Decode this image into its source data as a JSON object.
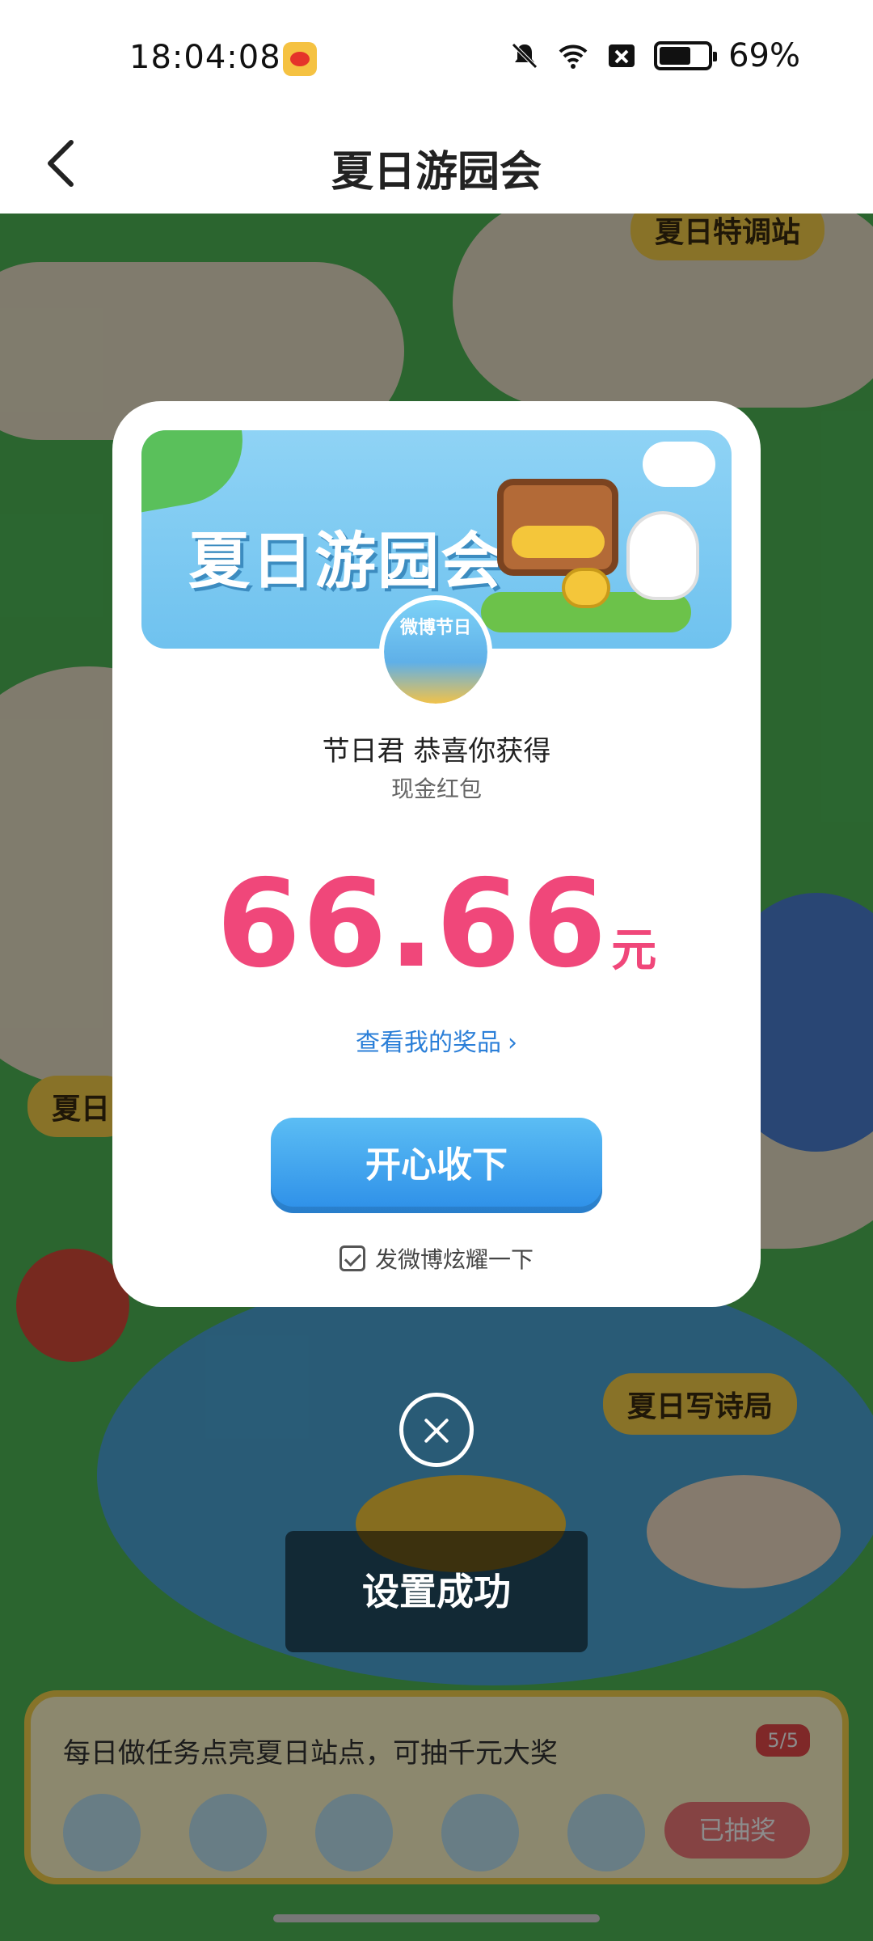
{
  "status_bar": {
    "time": "18:04:08",
    "battery": "69%",
    "icons": [
      "weibo-app-icon",
      "mute-icon",
      "wifi-icon",
      "sim-blocked-icon",
      "battery-icon"
    ]
  },
  "header": {
    "title": "夏日游园会",
    "back_icon": "chevron-left-icon"
  },
  "background": {
    "station_tags": [
      "夏日特调站",
      "夏日写诗局",
      "夏日"
    ],
    "task_panel": {
      "text": "每日做任务点亮夏日站点，可抽千元大奖",
      "progress": "5/5",
      "button": "已抽奖"
    }
  },
  "modal": {
    "banner_title": "夏日游园会",
    "avatar_label": "微博节日",
    "congrats": "节日君 恭喜你获得",
    "prize_type": "现金红包",
    "amount": "66.66",
    "unit": "元",
    "view_prizes": "查看我的奖品",
    "accept_button": "开心收下",
    "share_label": "发微博炫耀一下",
    "share_checked": true
  },
  "toast": {
    "text": "设置成功"
  },
  "colors": {
    "amount": "#f0477a",
    "link": "#2b7fd8",
    "button": "#2d8fe8"
  }
}
